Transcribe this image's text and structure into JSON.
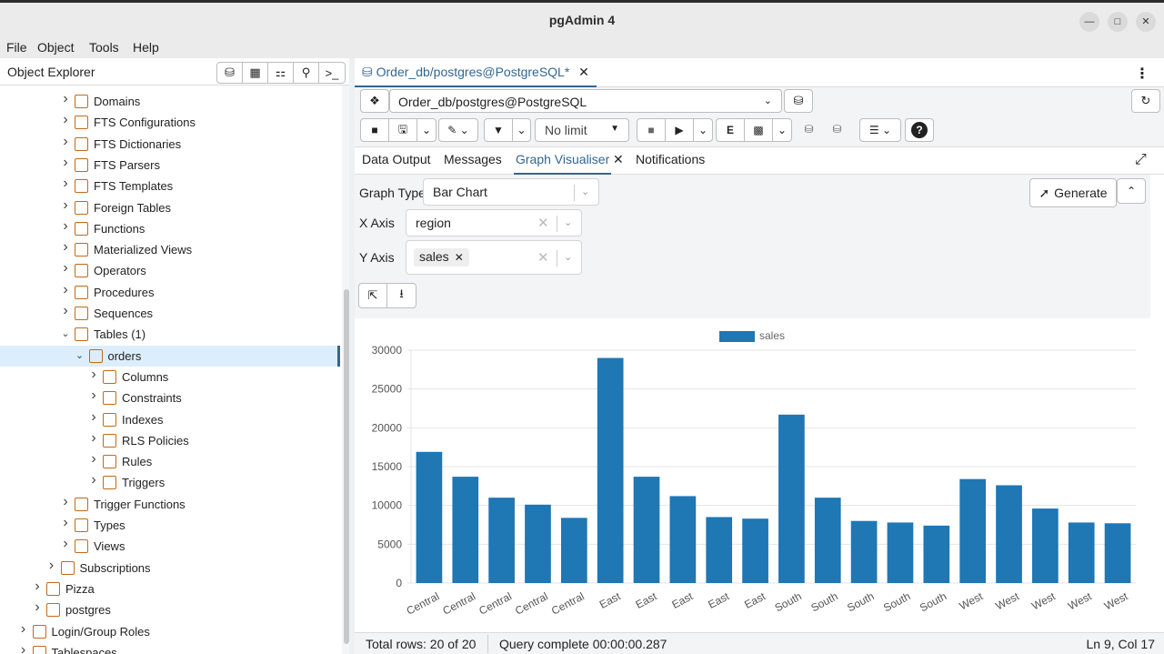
{
  "window": {
    "title": "pgAdmin 4"
  },
  "menu": [
    "File",
    "Object",
    "Tools",
    "Help"
  ],
  "object_explorer": {
    "title": "Object Explorer",
    "tree": [
      {
        "label": "Domains",
        "indent": 1,
        "icon": "domain-icon",
        "expanded": false
      },
      {
        "label": "FTS Configurations",
        "indent": 1,
        "icon": "fts-configuration-icon",
        "expanded": false
      },
      {
        "label": "FTS Dictionaries",
        "indent": 1,
        "icon": "fts-dictionary-icon",
        "expanded": false
      },
      {
        "label": "FTS Parsers",
        "indent": 1,
        "icon": "fts-parser-icon",
        "expanded": false
      },
      {
        "label": "FTS Templates",
        "indent": 1,
        "icon": "fts-template-icon",
        "expanded": false
      },
      {
        "label": "Foreign Tables",
        "indent": 1,
        "icon": "foreign-table-icon",
        "expanded": false
      },
      {
        "label": "Functions",
        "indent": 1,
        "icon": "function-icon",
        "expanded": false
      },
      {
        "label": "Materialized Views",
        "indent": 1,
        "icon": "materialized-view-icon",
        "expanded": false
      },
      {
        "label": "Operators",
        "indent": 1,
        "icon": "operator-icon",
        "expanded": false
      },
      {
        "label": "Procedures",
        "indent": 1,
        "icon": "procedure-icon",
        "expanded": false
      },
      {
        "label": "Sequences",
        "indent": 1,
        "icon": "sequence-icon",
        "expanded": false
      },
      {
        "label": "Tables (1)",
        "indent": 1,
        "icon": "table-icon",
        "expanded": true
      },
      {
        "label": "orders",
        "indent": 2,
        "icon": "table-icon",
        "expanded": true,
        "selected": true
      },
      {
        "label": "Columns",
        "indent": 3,
        "icon": "column-icon",
        "expanded": false
      },
      {
        "label": "Constraints",
        "indent": 3,
        "icon": "constraint-icon",
        "expanded": false
      },
      {
        "label": "Indexes",
        "indent": 3,
        "icon": "index-icon",
        "expanded": false
      },
      {
        "label": "RLS Policies",
        "indent": 3,
        "icon": "rls-policy-icon",
        "expanded": false
      },
      {
        "label": "Rules",
        "indent": 3,
        "icon": "rule-icon",
        "expanded": false
      },
      {
        "label": "Triggers",
        "indent": 3,
        "icon": "trigger-icon",
        "expanded": false
      },
      {
        "label": "Trigger Functions",
        "indent": 1,
        "icon": "trigger-function-icon",
        "expanded": false
      },
      {
        "label": "Types",
        "indent": 1,
        "icon": "type-icon",
        "expanded": false
      },
      {
        "label": "Views",
        "indent": 1,
        "icon": "view-icon",
        "expanded": false
      },
      {
        "label": "Subscriptions",
        "indent": 0,
        "icon": "subscription-icon",
        "expanded": false
      },
      {
        "label": "Pizza",
        "indent": -1,
        "icon": "database-icon",
        "expanded": false
      },
      {
        "label": "postgres",
        "indent": -1,
        "icon": "database-icon",
        "expanded": false
      },
      {
        "label": "Login/Group Roles",
        "indent": -2,
        "icon": "role-icon",
        "expanded": false
      },
      {
        "label": "Tablespaces",
        "indent": -2,
        "icon": "tablespace-icon",
        "expanded": false
      }
    ]
  },
  "query_tab": {
    "label": "Order_db/postgres@PostgreSQL*"
  },
  "connection": {
    "value": "Order_db/postgres@PostgreSQL"
  },
  "toolbar": {
    "limit_label": "No limit"
  },
  "result_tabs": {
    "data_output": "Data Output",
    "messages": "Messages",
    "graph_visualiser": "Graph Visualiser",
    "notifications": "Notifications"
  },
  "graph": {
    "graph_type_label": "Graph Type",
    "graph_type_value": "Bar Chart",
    "x_axis_label": "X Axis",
    "x_axis_value": "region",
    "y_axis_label": "Y Axis",
    "y_axis_chip": "sales",
    "generate_label": "Generate"
  },
  "chart_data": {
    "type": "bar",
    "categories": [
      "Central",
      "Central",
      "Central",
      "Central",
      "Central",
      "East",
      "East",
      "East",
      "East",
      "East",
      "South",
      "South",
      "South",
      "South",
      "South",
      "West",
      "West",
      "West",
      "West",
      "West"
    ],
    "series": [
      {
        "name": "sales",
        "color": "#1f77b4",
        "values": [
          16900,
          13700,
          11000,
          10100,
          8400,
          29000,
          13700,
          11200,
          8500,
          8300,
          21700,
          11000,
          8000,
          7800,
          7400,
          13400,
          12600,
          9600,
          7800,
          7700
        ]
      }
    ],
    "yticks": [
      0,
      5000,
      10000,
      15000,
      20000,
      25000,
      30000
    ],
    "ylim": [
      0,
      30000
    ],
    "legend": "top-center",
    "grid": true
  },
  "status": {
    "total_rows": "Total rows: 20 of 20",
    "query_complete": "Query complete 00:00:00.287",
    "cursor": "Ln 9, Col 17"
  }
}
